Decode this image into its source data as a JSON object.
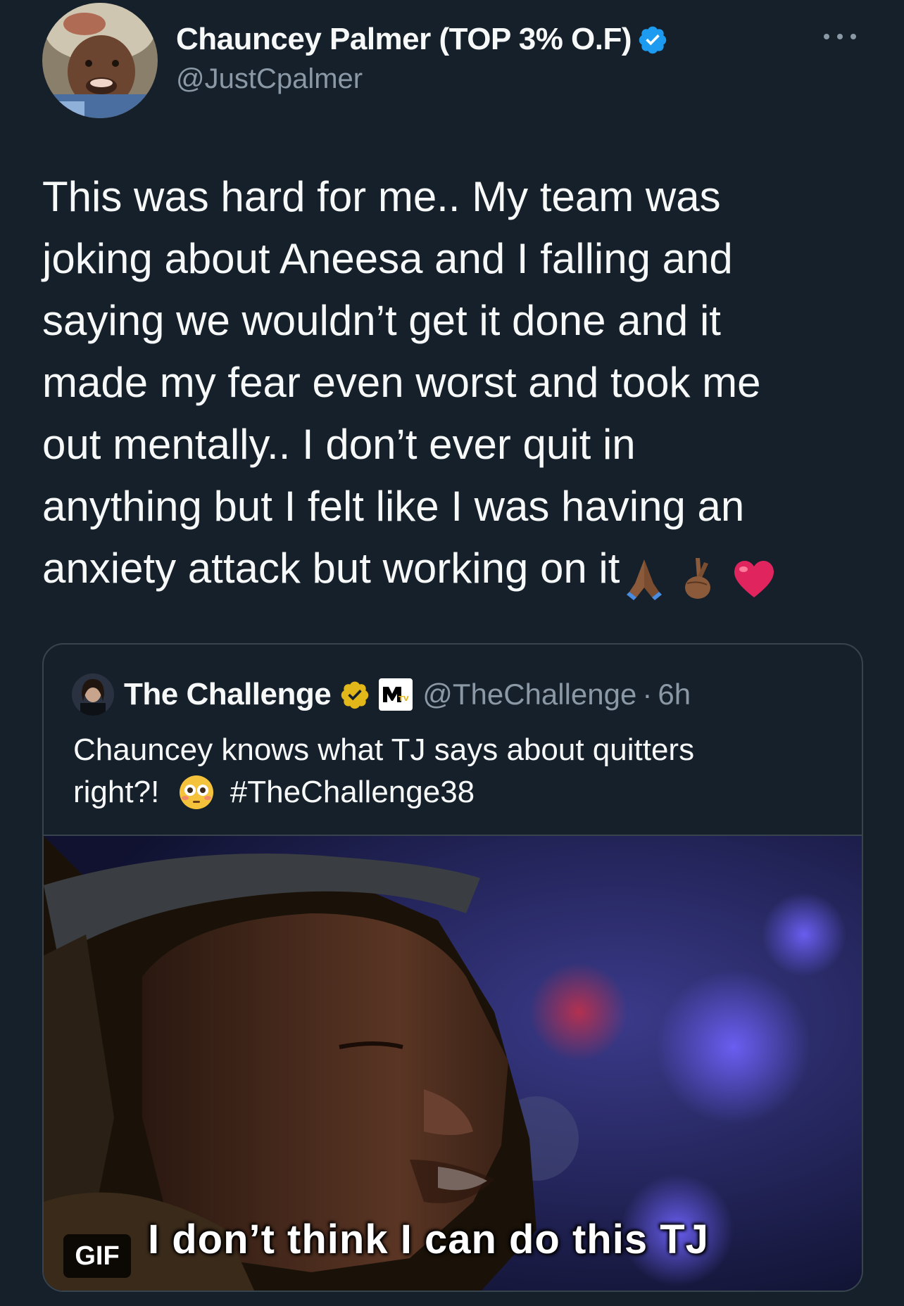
{
  "author": {
    "display_name": "Chauncey Palmer (TOP 3% O.F)",
    "handle": "@JustCpalmer",
    "verified": true,
    "badge_color": "#1d9bf0"
  },
  "tweet": {
    "lines": [
      "This was hard for me.. My team was",
      "joking about Aneesa and I falling and",
      "saying we wouldn’t get it done and it",
      "made my fear even worst and took me",
      "out mentally.. I don’t ever quit in",
      "anything but I felt like I was having an",
      "anxiety attack but working on it"
    ],
    "emojis": [
      "folded-hands",
      "crossed-fingers",
      "red-heart"
    ]
  },
  "quote": {
    "display_name": "The Challenge",
    "handle": "@TheChallenge",
    "separator": "·",
    "time": "6h",
    "affiliate_label": "MTV",
    "verified_badge_color": "#e2b719",
    "text_line1": "Chauncey knows what TJ says about quitters",
    "text_line2_start": "right?!",
    "text_line2_emoji": "flushed-face",
    "hashtag": "#TheChallenge38",
    "media": {
      "badge": "GIF",
      "caption": "I don’t think I can do this TJ"
    }
  },
  "colors": {
    "background": "#15202b",
    "text": "#f7f9f9",
    "secondary": "#8b98a5",
    "border": "#38444d"
  }
}
